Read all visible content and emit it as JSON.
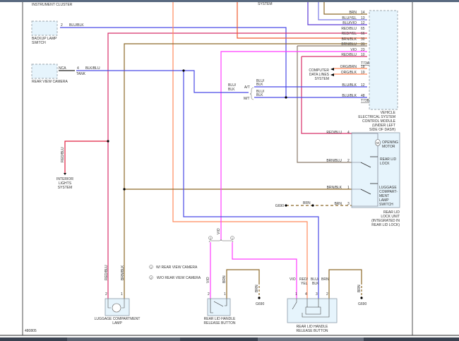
{
  "diagram_id": "480805",
  "colors": {
    "blue": "#4a4ae6",
    "brown": "#8e6a2a",
    "orange": "#ff8a5c",
    "red_orange": "#f05a30",
    "red_blu": "#d8306a",
    "violet": "#ff3cff",
    "blu_yel": "#7a7ae6",
    "blu_vio": "#5a3ad6",
    "module_fill": "#e6f4fc"
  },
  "headers": {
    "instrument_cluster": "INSTRUMENT CLUSTER",
    "system": "SYSTEM"
  },
  "backup_lamp_switch": {
    "name_1": "BACKUP LAMP",
    "name_2": "SWITCH",
    "pin": "2",
    "wire": "BLU/BLK"
  },
  "rear_view_camera": {
    "name": "REAR VIEW CAMERA",
    "nca": "NCA",
    "pin": "4",
    "tank": "TANK",
    "wire": "BLK/BLU"
  },
  "transmission": {
    "wire_in_1": "BLU/",
    "wire_in_2": "BLK",
    "at": "A/T",
    "mt": "M/T",
    "at_wire_1": "BLU/",
    "at_wire_2": "BLK",
    "mt_wire_1": "BLU/",
    "mt_wire_2": "BLK"
  },
  "vecm": {
    "name": [
      "VEHICLE",
      "ELECTRICAL SYSTEM",
      "CONTROL MODULE",
      "(UNDER LEFT",
      "SIDE OF DASH)"
    ],
    "pins": [
      {
        "wire": "BRN",
        "pin": "14"
      },
      {
        "wire": "BLU/YEL",
        "pin": "13"
      },
      {
        "wire": "BLU/VIO",
        "pin": "12"
      },
      {
        "wire": "RED/BLU",
        "pin": "65"
      },
      {
        "wire": "RED/YEL",
        "pin": "66"
      },
      {
        "wire": "BRN/BLK",
        "pin": "30"
      },
      {
        "wire": "BRN/BLU",
        "pin": "31"
      },
      {
        "wire": "VIO",
        "pin": "23"
      },
      {
        "wire": "RED/BLU",
        "pin": "10"
      },
      {
        "wire": "ORG/BRN",
        "pin": "18"
      },
      {
        "wire": "ORG/BLK",
        "pin": "19"
      },
      {
        "wire": "BLU/BLK",
        "pin": "12"
      },
      {
        "wire": "BLU/BLK",
        "pin": "48"
      }
    ],
    "connector_a": "T73A",
    "connector_b": "T73B"
  },
  "data_lines": [
    "COMPUTER",
    "DATA LINES",
    "SYSTEM"
  ],
  "rear_lid_lock_unit": {
    "name": [
      "REAR LID",
      "LOCK UNIT",
      "(INTEGRATED IN",
      "REAR LID LOCK)"
    ],
    "pins": [
      {
        "wire": "RED/BLU",
        "pin": "4"
      },
      {
        "wire": "BRN/BLU",
        "pin": "2"
      },
      {
        "wire": "BRN/BLK",
        "pin": "1"
      },
      {
        "wire": "BRN",
        "pin": "3"
      }
    ],
    "motor": "M",
    "motor_label": [
      "OPENING",
      "MOTOR"
    ],
    "lock_label": [
      "REAR LID",
      "LOCK"
    ],
    "switch_label": [
      "LUGGAGE",
      "COMPART-",
      "MENT",
      "LAMP",
      "SWITCH"
    ],
    "ground": "G690",
    "ground_wire": "BRN"
  },
  "interior_lights": {
    "wire": "RED/BLU",
    "name": [
      "INTERIOR",
      "LIGHTS",
      "SYSTEM"
    ]
  },
  "luggage_lamp": {
    "name": [
      "LUGGAGE COMPARTMENT",
      "LAMP"
    ],
    "pin_2": "2",
    "pin_1": "1",
    "wire_2": "RED/BLU",
    "wire_1": "BRN/BLK"
  },
  "legend": [
    {
      "num": "1",
      "text": "W/ REAR VIEW CAMERA"
    },
    {
      "num": "2",
      "text": "W/O REAR VIEW CAMERA"
    }
  ],
  "splice": {
    "wire": "VIO",
    "opt_2": "2",
    "opt_1": "1"
  },
  "button_left": {
    "name": [
      "REAR LID HANDLE",
      "RELEASE BUTTON"
    ],
    "pin_2": "2",
    "pin_1": "1",
    "wire_2": "VIO",
    "wire_1": "BRN",
    "ground_wire": "BRN",
    "ground": "G690"
  },
  "button_right": {
    "name": [
      "REAR LID HANDLE",
      "RELEASE BUTTON"
    ],
    "pins": [
      "1",
      "4",
      "3",
      "2"
    ],
    "wire_1": "VIO",
    "wire_4a": "RED/",
    "wire_4b": "YEL",
    "wire_3a": "BLU/",
    "wire_3b": "BLK",
    "wire_2": "BRN",
    "ground_wire": "BRN",
    "ground": "G690"
  }
}
